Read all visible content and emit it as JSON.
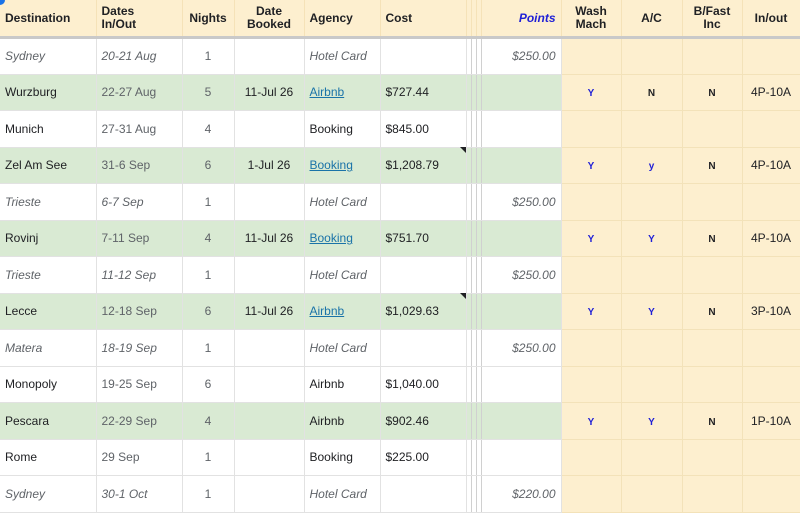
{
  "headers": {
    "destination": "Destination",
    "dates_line1": "Dates",
    "dates_line2": "In/Out",
    "nights": "Nights",
    "booked_line1": "Date",
    "booked_line2": "Booked",
    "agency": "Agency",
    "cost": "Cost",
    "points": "Points",
    "wash_line1": "Wash",
    "wash_line2": "Mach",
    "ac": "A/C",
    "bfast_line1": "B/Fast",
    "bfast_line2": "Inc",
    "inout": "In/out"
  },
  "rows": [
    {
      "destination": "Sydney",
      "dates": "20-21 Aug",
      "nights": "1",
      "booked": "",
      "agency": "Hotel Card",
      "cost": "",
      "points": "$250.00",
      "wash": "",
      "ac": "",
      "bfast": "",
      "inout": ""
    },
    {
      "destination": "Wurzburg",
      "dates": "22-27 Aug",
      "nights": "5",
      "booked": "11-Jul 26",
      "agency": "Airbnb",
      "cost": "$727.44",
      "points": "",
      "wash": "Y",
      "ac": "N",
      "bfast": "N",
      "inout": "4P-10A"
    },
    {
      "destination": "Munich",
      "dates": "27-31 Aug",
      "nights": "4",
      "booked": "",
      "agency": "Booking",
      "cost": "$845.00",
      "points": "",
      "wash": "",
      "ac": "",
      "bfast": "",
      "inout": ""
    },
    {
      "destination": "Zel Am See",
      "dates": "31-6 Sep",
      "nights": "6",
      "booked": "1-Jul 26",
      "agency": "Booking",
      "cost": "$1,208.79",
      "points": "",
      "wash": "Y",
      "ac": "y",
      "bfast": "N",
      "inout": "4P-10A"
    },
    {
      "destination": "Trieste",
      "dates": "6-7 Sep",
      "nights": "1",
      "booked": "",
      "agency": "Hotel Card",
      "cost": "",
      "points": "$250.00",
      "wash": "",
      "ac": "",
      "bfast": "",
      "inout": ""
    },
    {
      "destination": "Rovinj",
      "dates": "7-11 Sep",
      "nights": "4",
      "booked": "11-Jul 26",
      "agency": "Booking",
      "cost": "$751.70",
      "points": "",
      "wash": "Y",
      "ac": "Y",
      "bfast": "N",
      "inout": "4P-10A"
    },
    {
      "destination": "Trieste",
      "dates": "11-12 Sep",
      "nights": "1",
      "booked": "",
      "agency": "Hotel Card",
      "cost": "",
      "points": "$250.00",
      "wash": "",
      "ac": "",
      "bfast": "",
      "inout": ""
    },
    {
      "destination": "Lecce",
      "dates": "12-18 Sep",
      "nights": "6",
      "booked": "11-Jul 26",
      "agency": "Airbnb",
      "cost": "$1,029.63",
      "points": "",
      "wash": "Y",
      "ac": "Y",
      "bfast": "N",
      "inout": "3P-10A"
    },
    {
      "destination": "Matera",
      "dates": "18-19 Sep",
      "nights": "1",
      "booked": "",
      "agency": "Hotel Card",
      "cost": "",
      "points": "$250.00",
      "wash": "",
      "ac": "",
      "bfast": "",
      "inout": ""
    },
    {
      "destination": "Monopoly",
      "dates": "19-25 Sep",
      "nights": "6",
      "booked": "",
      "agency": "Airbnb",
      "cost": "$1,040.00",
      "points": "",
      "wash": "",
      "ac": "",
      "bfast": "",
      "inout": ""
    },
    {
      "destination": "Pescara",
      "dates": "22-29 Sep",
      "nights": "4",
      "booked": "",
      "agency": "Airbnb",
      "cost": "$902.46",
      "points": "",
      "wash": "Y",
      "ac": "Y",
      "bfast": "N",
      "inout": "1P-10A"
    },
    {
      "destination": "Rome",
      "dates": "29 Sep",
      "nights": "1",
      "booked": "",
      "agency": "Booking",
      "cost": "$225.00",
      "points": "",
      "wash": "",
      "ac": "",
      "bfast": "",
      "inout": ""
    },
    {
      "destination": "Sydney",
      "dates": "30-1 Oct",
      "nights": "1",
      "booked": "",
      "agency": "Hotel Card",
      "cost": "",
      "points": "$220.00",
      "wash": "",
      "ac": "",
      "bfast": "",
      "inout": ""
    }
  ],
  "colors": {
    "header_bg": "#fdefcf",
    "booked_row_bg": "#d9ead3",
    "points_header": "#1f1fd6",
    "link": "#1a73a8"
  }
}
